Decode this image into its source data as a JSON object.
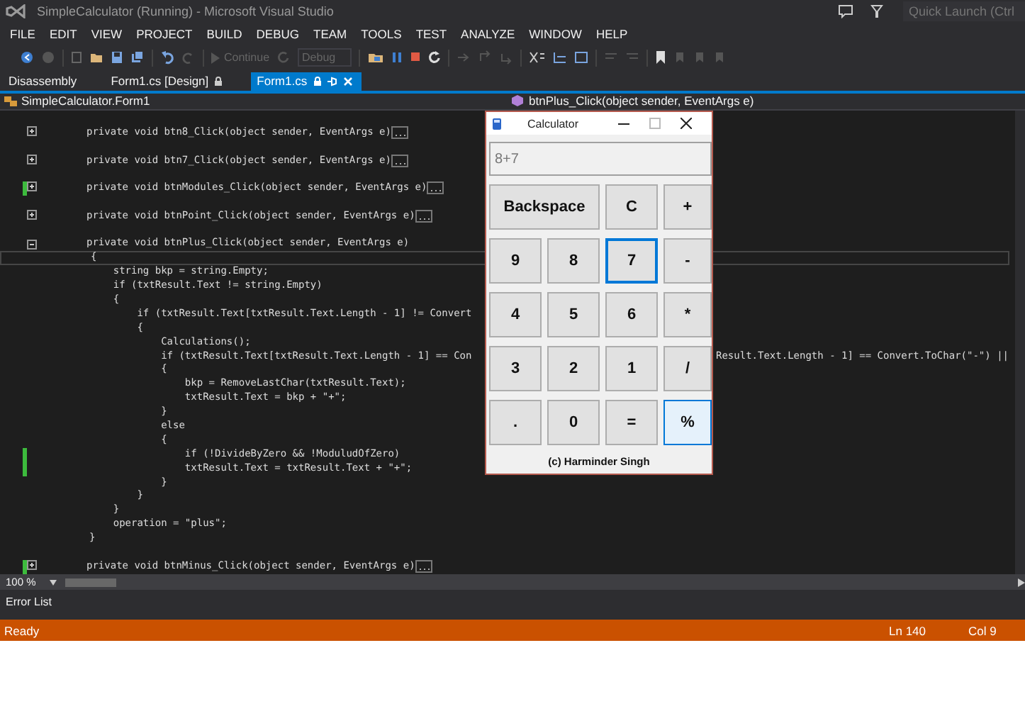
{
  "window": {
    "title": "SimpleCalculator (Running) - Microsoft Visual Studio",
    "quick_launch": {
      "placeholder": "Quick Launch (Ctrl"
    }
  },
  "menu": [
    "FILE",
    "EDIT",
    "VIEW",
    "PROJECT",
    "BUILD",
    "DEBUG",
    "TEAM",
    "TOOLS",
    "TEST",
    "ANALYZE",
    "WINDOW",
    "HELP"
  ],
  "toolbar": {
    "continue_label": "Continue",
    "configuration": "Debug"
  },
  "tabs": [
    {
      "label": "Disassembly",
      "selected": false,
      "locked": false
    },
    {
      "label": "Form1.cs [Design]",
      "selected": false,
      "locked": true
    },
    {
      "label": "Form1.cs",
      "selected": true,
      "locked": true
    }
  ],
  "navigation": {
    "class": "SimpleCalculator.Form1",
    "member": "btnPlus_Click(object sender, EventArgs e)"
  },
  "code_lines": [
    {
      "kind": "collapsed",
      "text": "private void btn8_Click(object sender, EventArgs e)",
      "changed": false,
      "current": false
    },
    {
      "kind": "collapsed",
      "text": "private void btn7_Click(object sender, EventArgs e)",
      "changed": false,
      "current": false
    },
    {
      "kind": "collapsed",
      "text": "private void btnModules_Click(object sender, EventArgs e)",
      "changed": true,
      "current": false
    },
    {
      "kind": "collapsed",
      "text": "private void btnPoint_Click(object sender, EventArgs e)",
      "changed": false,
      "current": false
    },
    {
      "kind": "header",
      "text": "private void btnPlus_Click(object sender, EventArgs e)",
      "changed": false,
      "current": false
    },
    {
      "kind": "plain",
      "text": "{",
      "changed": false,
      "current": true
    },
    {
      "kind": "plain",
      "text": "    string bkp = string.Empty;",
      "changed": false,
      "current": false
    },
    {
      "kind": "plain",
      "text": "    if (txtResult.Text != string.Empty)",
      "changed": false,
      "current": false
    },
    {
      "kind": "plain",
      "text": "    {",
      "changed": false,
      "current": false
    },
    {
      "kind": "plain",
      "text": "        if (txtResult.Text[txtResult.Text.Length - 1] != Convert",
      "changed": false,
      "current": false
    },
    {
      "kind": "plain",
      "text": "        {",
      "changed": false,
      "current": false
    },
    {
      "kind": "plain",
      "text": "            Calculations();",
      "changed": false,
      "current": false
    },
    {
      "kind": "plain",
      "text": "            if (txtResult.Text[txtResult.Text.Length - 1] == Con",
      "continuation": "Result.Text.Length - 1] == Convert.ToChar(\"-\") ||",
      "changed": false,
      "current": false
    },
    {
      "kind": "plain",
      "text": "            {",
      "changed": false,
      "current": false
    },
    {
      "kind": "plain",
      "text": "                bkp = RemoveLastChar(txtResult.Text);",
      "changed": false,
      "current": false
    },
    {
      "kind": "plain",
      "text": "                txtResult.Text = bkp + \"+\";",
      "changed": false,
      "current": false
    },
    {
      "kind": "plain",
      "text": "            }",
      "changed": false,
      "current": false
    },
    {
      "kind": "plain",
      "text": "            else",
      "changed": false,
      "current": false
    },
    {
      "kind": "plain",
      "text": "            {",
      "changed": false,
      "current": false
    },
    {
      "kind": "plain",
      "text": "                if (!DivideByZero && !ModuludOfZero)",
      "changed": true,
      "current": false
    },
    {
      "kind": "plain",
      "text": "                txtResult.Text = txtResult.Text + \"+\";",
      "changed": true,
      "current": false
    },
    {
      "kind": "plain",
      "text": "            }",
      "changed": false,
      "current": false
    },
    {
      "kind": "plain",
      "text": "        }",
      "changed": false,
      "current": false
    },
    {
      "kind": "plain",
      "text": "    }",
      "changed": false,
      "current": false
    },
    {
      "kind": "plain",
      "text": "    operation = \"plus\";",
      "changed": false,
      "current": false
    },
    {
      "kind": "plain",
      "text": "}",
      "changed": false,
      "current": false
    },
    {
      "kind": "collapsed",
      "text": "private void btnMinus_Click(object sender, EventArgs e)",
      "changed": true,
      "current": false
    }
  ],
  "zoom": "100 %",
  "panel_tab": "Error List",
  "status_bar": {
    "message": "Ready",
    "line": "Ln 140",
    "column": "Col 9"
  },
  "calculator": {
    "title": "Calculator",
    "display": {
      "value": "8+7"
    },
    "buttons": [
      {
        "label": "Backspace",
        "wide": true,
        "focused": false,
        "hover": false
      },
      {
        "label": "C",
        "wide": false,
        "focused": false,
        "hover": false
      },
      {
        "label": "+",
        "wide": false,
        "focused": false,
        "hover": false
      },
      {
        "label": "9",
        "wide": false,
        "focused": false,
        "hover": false
      },
      {
        "label": "8",
        "wide": false,
        "focused": false,
        "hover": false
      },
      {
        "label": "7",
        "wide": false,
        "focused": true,
        "hover": false
      },
      {
        "label": "-",
        "wide": false,
        "focused": false,
        "hover": false
      },
      {
        "label": "4",
        "wide": false,
        "focused": false,
        "hover": false
      },
      {
        "label": "5",
        "wide": false,
        "focused": false,
        "hover": false
      },
      {
        "label": "6",
        "wide": false,
        "focused": false,
        "hover": false
      },
      {
        "label": "*",
        "wide": false,
        "focused": false,
        "hover": false
      },
      {
        "label": "3",
        "wide": false,
        "focused": false,
        "hover": false
      },
      {
        "label": "2",
        "wide": false,
        "focused": false,
        "hover": false
      },
      {
        "label": "1",
        "wide": false,
        "focused": false,
        "hover": false
      },
      {
        "label": "/",
        "wide": false,
        "focused": false,
        "hover": false
      },
      {
        "label": ".",
        "wide": false,
        "focused": false,
        "hover": false
      },
      {
        "label": "0",
        "wide": false,
        "focused": false,
        "hover": false
      },
      {
        "label": "=",
        "wide": false,
        "focused": false,
        "hover": false
      },
      {
        "label": "%",
        "wide": false,
        "focused": false,
        "hover": true
      }
    ],
    "credit": "(c) Harminder Singh"
  }
}
